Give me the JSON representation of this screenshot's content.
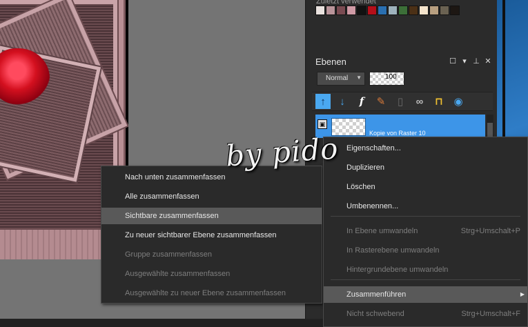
{
  "recent_colors": {
    "label": "Zuletzt verwendet",
    "swatches": [
      "#e9e2df",
      "#b9949a",
      "#7a4b52",
      "#cf9aa5",
      "#111111",
      "#b40f1a",
      "#2a6fb0",
      "#9eb2bc",
      "#3c6f38",
      "#4b3016",
      "#f4e4cc",
      "#b89f80",
      "#6a6252",
      "#1d1713"
    ]
  },
  "layers": {
    "title": "Ebenen",
    "blend_mode": "Normal",
    "opacity": "100",
    "layer_name": "Kopie von Raster 10"
  },
  "submenu": {
    "items": [
      {
        "label": "Nach unten zusammenfassen",
        "enabled": true
      },
      {
        "label": "Alle zusammenfassen",
        "enabled": true
      },
      {
        "label": "Sichtbare zusammenfassen",
        "enabled": true,
        "highlighted": true
      },
      {
        "label": "Zu neuer sichtbarer Ebene zusammenfassen",
        "enabled": true
      },
      {
        "label": "Gruppe zusammenfassen",
        "enabled": false
      },
      {
        "label": "Ausgewählte zusammenfassen",
        "enabled": false
      },
      {
        "label": "Ausgewählte zu neuer Ebene zusammenfassen",
        "enabled": false
      }
    ]
  },
  "context_menu": {
    "items": [
      {
        "label": "Eigenschaften...",
        "enabled": true
      },
      {
        "label": "Duplizieren",
        "enabled": true
      },
      {
        "label": "Löschen",
        "enabled": true
      },
      {
        "label": "Umbenennen...",
        "enabled": true
      },
      {
        "label": "In Ebene umwandeln",
        "shortcut": "Strg+Umschalt+P",
        "enabled": false
      },
      {
        "label": "In Rasterebene umwandeln",
        "enabled": false
      },
      {
        "label": "Hintergrundebene umwandeln",
        "enabled": false
      },
      {
        "label": "Zusammenführen",
        "enabled": true,
        "highlighted": true,
        "has_submenu": true
      },
      {
        "label": "Nicht schwebend",
        "shortcut": "Strg+Umschalt+F",
        "enabled": false
      }
    ]
  },
  "watermark": "by pido"
}
